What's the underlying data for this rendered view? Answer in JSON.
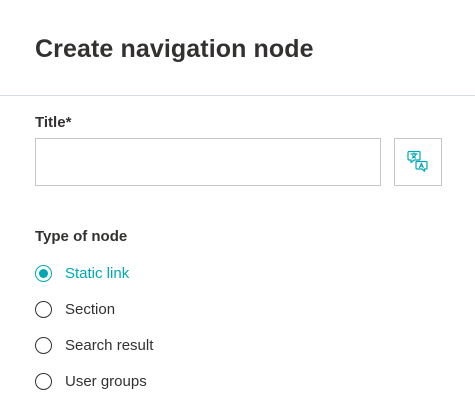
{
  "header": {
    "title": "Create navigation node"
  },
  "form": {
    "title_field": {
      "label": "Title*",
      "value": "",
      "placeholder": ""
    },
    "translate_icon": "translate-icon",
    "type_of_node": {
      "label": "Type of node",
      "options": [
        "Static link",
        "Section",
        "Search result",
        "User groups"
      ],
      "selected": "Static link"
    }
  },
  "colors": {
    "accent": "#00a8b5",
    "text": "#323130",
    "border": "#c8c6c4",
    "divider": "#d8dbe8"
  }
}
